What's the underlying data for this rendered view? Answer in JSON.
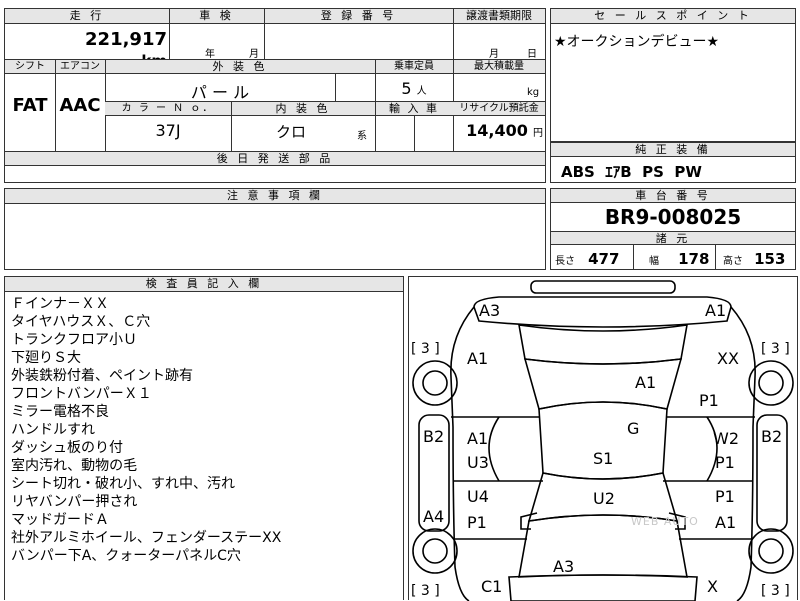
{
  "top": {
    "mileage_header": "走 行",
    "mileage_value": "221,917",
    "mileage_unit": "km",
    "inspection_header": "車 検",
    "inspection_year": "年",
    "inspection_month": "月",
    "registration_header": "登 録 番 号",
    "transfer_header": "譲渡書類期限",
    "transfer_month": "月",
    "transfer_day": "日",
    "shift_header": "シフト",
    "shift_value": "FAT",
    "ac_header": "エアコン",
    "ac_value": "AAC",
    "exterior_header": "外 装 色",
    "exterior_value": "パ ー ル",
    "capacity_header": "乗車定員",
    "capacity_value": "5",
    "capacity_unit": "人",
    "maxload_header": "最大積載量",
    "maxload_unit": "kg",
    "color_no_header": "カ ラ ー Ｎ ｏ．",
    "color_no_value": "37J",
    "interior_header": "内 装 色",
    "interior_value": "クロ",
    "interior_unit": "系",
    "import_header": "輸 入 車",
    "recycle_header": "リサイクル預託金",
    "recycle_value": "14,400",
    "recycle_unit": "円",
    "later_parts_header": "後 日 発 送 部 品"
  },
  "sales": {
    "header": "セ ー ル ス ポ イ ン ト",
    "text": "★オークションデビュー★"
  },
  "equipment": {
    "header": "純 正 装 備",
    "text": "ABS  ｴｱB  PS  PW"
  },
  "caution": {
    "header": "注 意 事 項 欄"
  },
  "chassis": {
    "header": "車 台 番 号",
    "value": "BR9-008025",
    "specs_header": "諸 元",
    "length_label": "長さ",
    "length_value": "477",
    "width_label": "幅",
    "width_value": "178",
    "height_label": "高さ",
    "height_value": "153"
  },
  "inspector": {
    "header": "検 査 員 記 入 欄",
    "notes": [
      "Ｆインナ－ＸＸ",
      "タイヤハウスＸ、Ｃ穴",
      "トランクフロア小Ｕ",
      "下廻りＳ大",
      "外装鉄粉付着、ペイント跡有",
      "フロントバンパーＸ１",
      "ミラー電格不良",
      "ハンドルすれ",
      "ダッシュ板のり付",
      "室内汚れ、動物の毛",
      "シート切れ・破れ小、すれ中、汚れ",
      "リヤバンパー押され",
      "マッドガードＡ",
      "社外アルミホイール、フェンダーステーXX",
      "バンパー下A、クォーターパネルC穴"
    ]
  },
  "diagram": {
    "labels": {
      "rear_left": "A3",
      "rear_right": "A1",
      "tire_rl": "[ 3 ]",
      "tire_rr": "[ 3 ]",
      "tire_fl": "[ 3 ]",
      "tire_fr": "[ 3 ]",
      "qp_left": "A1",
      "qp_right": "XX",
      "trunk": "A1",
      "right_rear_p1": "P1",
      "roof": "G",
      "pillar_left": "B2",
      "pillar_right": "B2",
      "rdoor_left_a1": "A1",
      "rdoor_left_u3": "U3",
      "rdoor_right_w2": "W2",
      "rdoor_right_p1": "P1",
      "seat_rear": "S1",
      "seat_front": "U2",
      "fdoor_left_u4": "U4",
      "fdoor_left_p1": "P1",
      "fdoor_right_p1": "P1",
      "fdoor_right_a1": "A1",
      "sill_left": "A4",
      "hood": "A3",
      "fender_left": "C1",
      "fender_right": "X"
    },
    "watermark": "WEB AUTO"
  }
}
